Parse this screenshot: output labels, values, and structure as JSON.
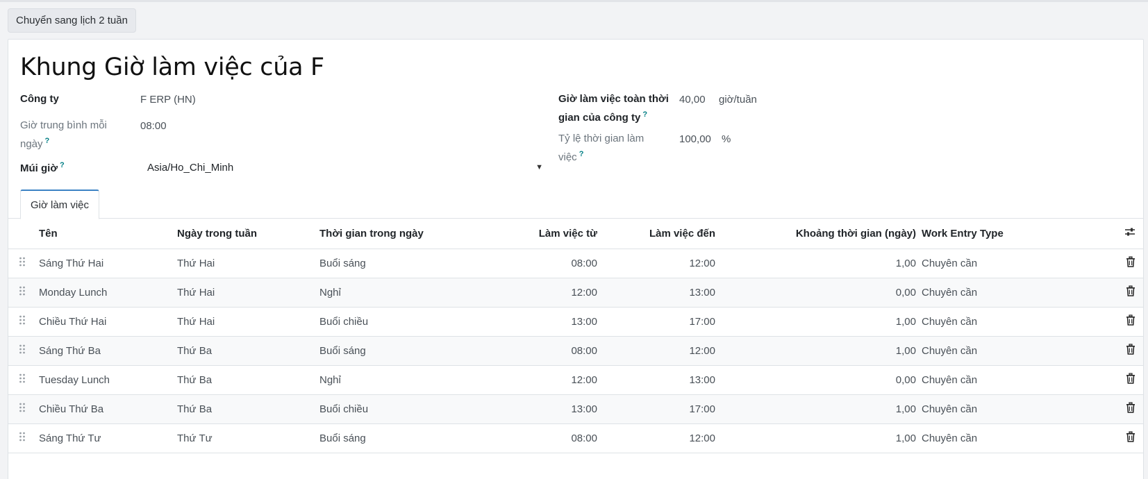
{
  "toolbar": {
    "switch_button": "Chuyển sang lịch 2 tuần"
  },
  "form": {
    "title": "Khung Giờ làm việc của F",
    "company_label": "Công ty",
    "company_value": "F ERP (HN)",
    "avg_hours_label": "Giờ trung bình mỗi ngày",
    "avg_hours_value": "08:00",
    "timezone_label": "Múi giờ",
    "timezone_value": "Asia/Ho_Chi_Minh",
    "fulltime_label": "Giờ làm việc toàn thời gian của công ty",
    "fulltime_value": "40,00",
    "fulltime_unit": "giờ/tuần",
    "rate_label": "Tỷ lệ thời gian làm việc",
    "rate_value": "100,00",
    "rate_unit": "%",
    "help_mark": "?"
  },
  "tabs": [
    {
      "label": "Giờ làm việc"
    }
  ],
  "table": {
    "columns": {
      "name": "Tên",
      "dayofweek": "Ngày trong tuần",
      "period": "Thời gian trong ngày",
      "from": "Làm việc từ",
      "to": "Làm việc đến",
      "duration": "Khoảng thời gian (ngày)",
      "work_entry": "Work Entry Type"
    },
    "rows": [
      {
        "name": "Sáng Thứ Hai",
        "day": "Thứ Hai",
        "period": "Buổi sáng",
        "from": "08:00",
        "to": "12:00",
        "duration": "1,00",
        "type": "Chuyên cần"
      },
      {
        "name": "Monday Lunch",
        "day": "Thứ Hai",
        "period": "Nghỉ",
        "from": "12:00",
        "to": "13:00",
        "duration": "0,00",
        "type": "Chuyên cần"
      },
      {
        "name": "Chiều Thứ Hai",
        "day": "Thứ Hai",
        "period": "Buổi chiều",
        "from": "13:00",
        "to": "17:00",
        "duration": "1,00",
        "type": "Chuyên cần"
      },
      {
        "name": "Sáng Thứ Ba",
        "day": "Thứ Ba",
        "period": "Buổi sáng",
        "from": "08:00",
        "to": "12:00",
        "duration": "1,00",
        "type": "Chuyên cần"
      },
      {
        "name": "Tuesday Lunch",
        "day": "Thứ Ba",
        "period": "Nghỉ",
        "from": "12:00",
        "to": "13:00",
        "duration": "0,00",
        "type": "Chuyên cần"
      },
      {
        "name": "Chiều Thứ Ba",
        "day": "Thứ Ba",
        "period": "Buổi chiều",
        "from": "13:00",
        "to": "17:00",
        "duration": "1,00",
        "type": "Chuyên cần"
      },
      {
        "name": "Sáng Thứ Tư",
        "day": "Thứ Tư",
        "period": "Buổi sáng",
        "from": "08:00",
        "to": "12:00",
        "duration": "1,00",
        "type": "Chuyên cần"
      }
    ]
  },
  "icons": {
    "drag": "drag-handle-icon",
    "delete": "trash-icon",
    "settings": "sliders-icon",
    "dropdown": "caret-down-icon"
  }
}
